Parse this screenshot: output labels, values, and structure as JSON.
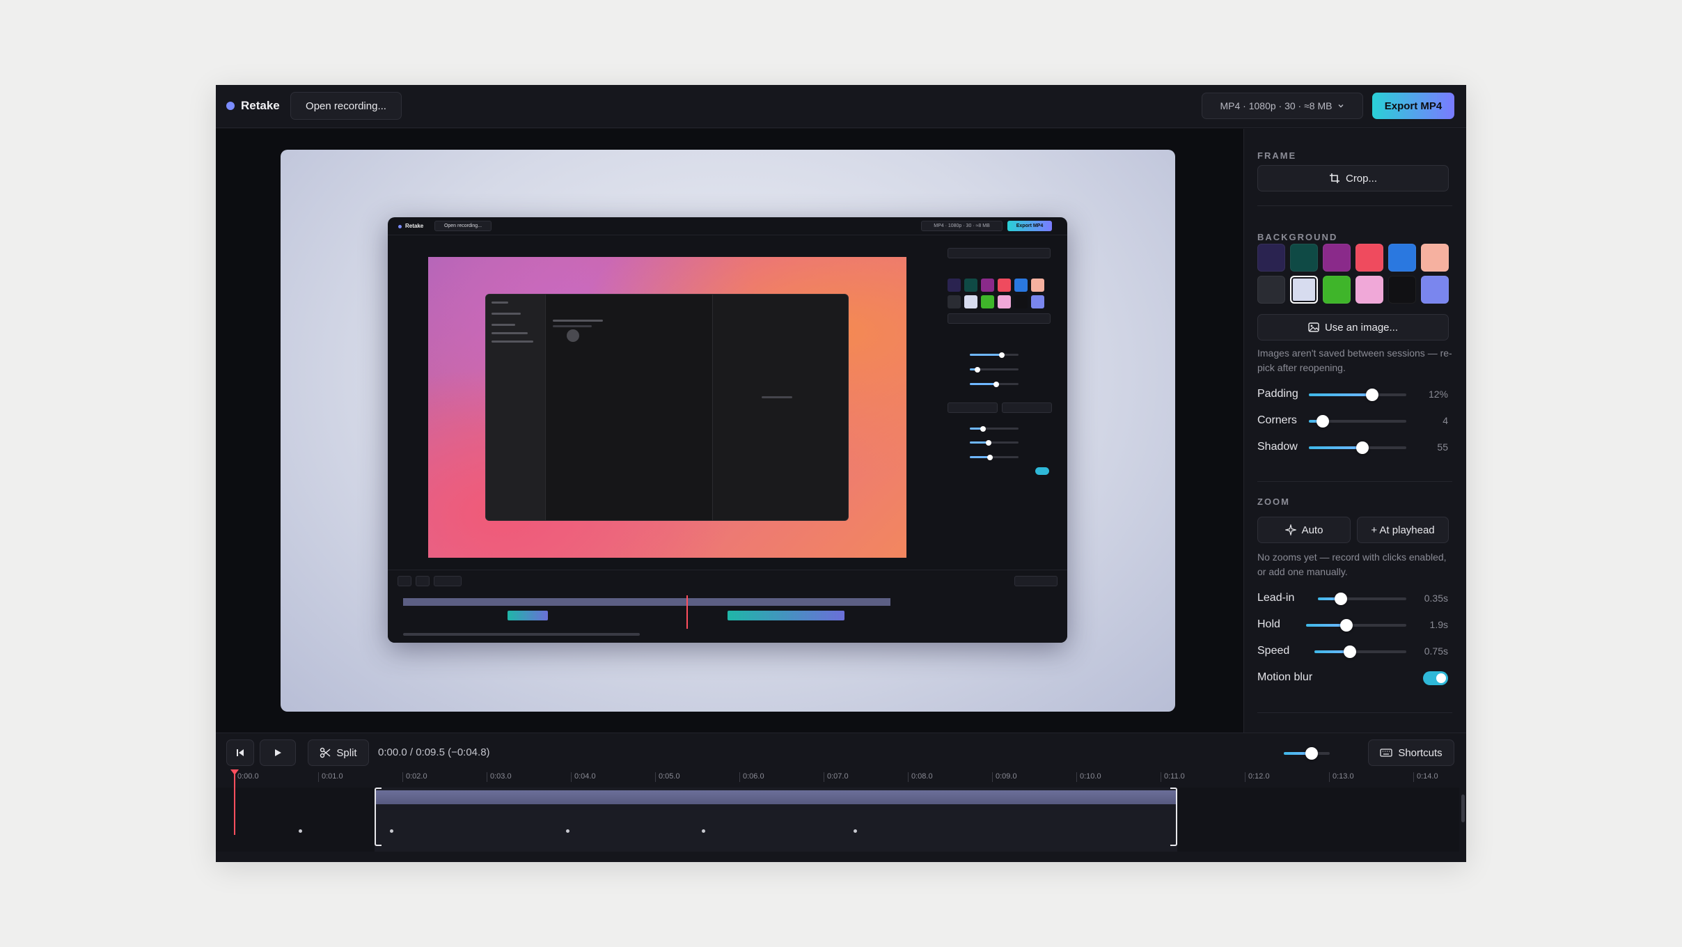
{
  "app": {
    "brand": "Retake",
    "open_label": "Open recording...",
    "format_label": "MP4 · 1080p · 30 · ≈8 MB",
    "export_label": "Export MP4"
  },
  "preview": {
    "brand": "Retake",
    "open_label": "Open recording...",
    "format_label": "MP4 · 1080p · 30 · ≈8 MB",
    "export_label": "Export MP4"
  },
  "panel": {
    "frame": {
      "label": "FRAME",
      "crop_label": "Crop..."
    },
    "background": {
      "label": "BACKGROUND",
      "swatches": [
        {
          "name": "deep-indigo",
          "color": "#2a2350"
        },
        {
          "name": "deep-teal",
          "color": "#0f4a45"
        },
        {
          "name": "magenta",
          "color": "#8a2a8a"
        },
        {
          "name": "coral",
          "color": "#ef4b5e"
        },
        {
          "name": "blue",
          "color": "#2a78e0"
        },
        {
          "name": "peach",
          "color": "#f6b1a0"
        },
        {
          "name": "charcoal",
          "color": "#2a2c33"
        },
        {
          "name": "pale-lavender",
          "color": "#d7dcef",
          "selected": true
        },
        {
          "name": "green",
          "color": "#3fb52a"
        },
        {
          "name": "pink-pastel",
          "color": "#f0a8d8"
        },
        {
          "name": "black",
          "color": "#111114"
        },
        {
          "name": "periwinkle",
          "color": "#7a86ee"
        }
      ],
      "use_image_label": "Use an image...",
      "hint": "Images aren't saved between sessions — re-pick after reopening.",
      "padding": {
        "label": "Padding",
        "value": "12%",
        "fraction": 0.65
      },
      "corners": {
        "label": "Corners",
        "value": "4",
        "fraction": 0.14
      },
      "shadow": {
        "label": "Shadow",
        "value": "55",
        "fraction": 0.55
      }
    },
    "zoom": {
      "label": "ZOOM",
      "auto_label": "Auto",
      "at_playhead_label": "+ At playhead",
      "hint": "No zooms yet — record with clicks enabled, or add one manually.",
      "lead_in": {
        "label": "Lead-in",
        "value": "0.35s",
        "fraction": 0.26
      },
      "hold": {
        "label": "Hold",
        "value": "1.9s",
        "fraction": 0.4
      },
      "speed": {
        "label": "Speed",
        "value": "0.75s",
        "fraction": 0.39
      },
      "motion_blur": {
        "label": "Motion blur",
        "on": true
      }
    }
  },
  "timeline": {
    "split_label": "Split",
    "timecode": "0:00.0 / 0:09.5 (−0:04.8)",
    "shortcuts_label": "Shortcuts",
    "zoom_fraction": 0.6,
    "ticks": [
      "0:00.0",
      "0:01.0",
      "0:02.0",
      "0:03.0",
      "0:04.0",
      "0:05.0",
      "0:06.0",
      "0:07.0",
      "0:08.0",
      "0:09.0",
      "0:10.0",
      "0:11.0",
      "0:12.0",
      "0:13.0",
      "0:14.0"
    ]
  },
  "colors": {
    "accent": "#6fb7ff",
    "export_gradient_start": "#2ad0d6",
    "export_gradient_end": "#7a7bff",
    "playhead": "#ff4f5e"
  }
}
